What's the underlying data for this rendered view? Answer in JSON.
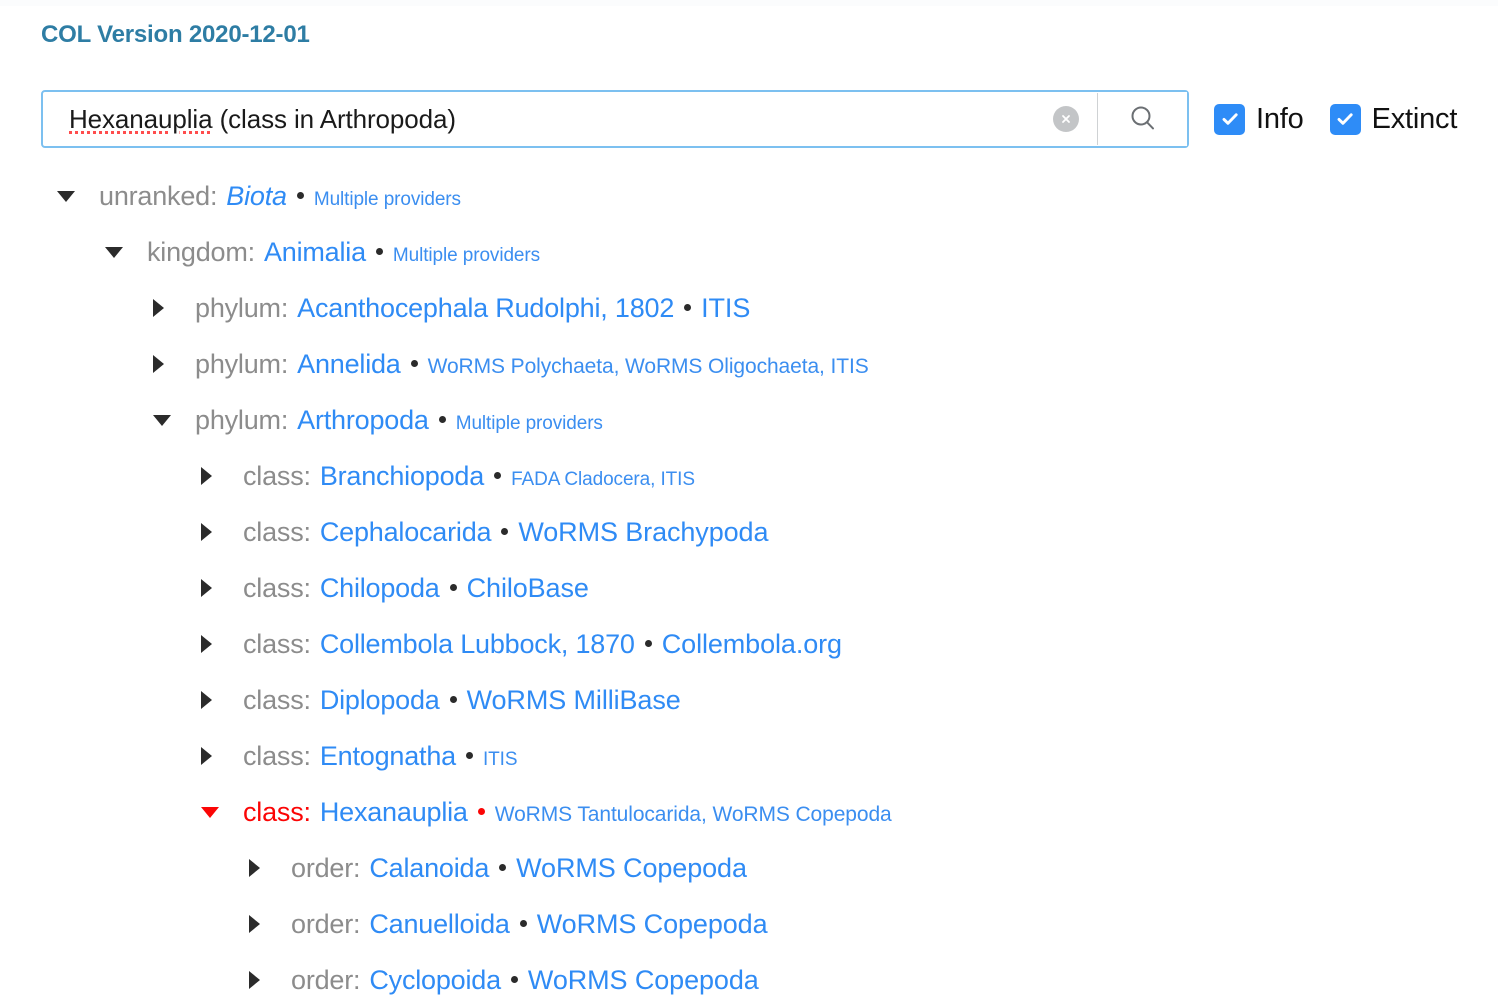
{
  "header": {
    "title": "COL Version 2020-12-01"
  },
  "search": {
    "value": "Hexanauplia (class in Arthropoda)",
    "misspelled_part": "Hexanauplia",
    "rest_part": " (class in Arthropoda)",
    "clear_icon": "clear-circle-x-icon",
    "search_icon": "magnifier-icon"
  },
  "options": [
    {
      "label": "Info",
      "checked": true
    },
    {
      "label": "Extinct",
      "checked": true
    }
  ],
  "tree": [
    {
      "level": 0,
      "state": "expanded",
      "rank": "unranked:",
      "name": "Biota",
      "italic": true,
      "providers": "Multiple providers",
      "provider_size": "sm",
      "selected": false
    },
    {
      "level": 1,
      "state": "expanded",
      "rank": "kingdom:",
      "name": "Animalia",
      "italic": false,
      "providers": "Multiple providers",
      "provider_size": "sm",
      "selected": false
    },
    {
      "level": 2,
      "state": "collapsed",
      "rank": "phylum:",
      "name": "Acanthocephala Rudolphi, 1802",
      "italic": false,
      "providers": "ITIS",
      "provider_size": "lg",
      "selected": false
    },
    {
      "level": 2,
      "state": "collapsed",
      "rank": "phylum:",
      "name": "Annelida",
      "italic": false,
      "providers": "WoRMS Polychaeta, WoRMS Oligochaeta, ITIS",
      "provider_size": "md",
      "selected": false
    },
    {
      "level": 2,
      "state": "expanded",
      "rank": "phylum:",
      "name": "Arthropoda",
      "italic": false,
      "providers": "Multiple providers",
      "provider_size": "sm",
      "selected": false
    },
    {
      "level": 3,
      "state": "collapsed",
      "rank": "class:",
      "name": "Branchiopoda",
      "italic": false,
      "providers": "FADA Cladocera, ITIS",
      "provider_size": "sm",
      "selected": false
    },
    {
      "level": 3,
      "state": "collapsed",
      "rank": "class:",
      "name": "Cephalocarida",
      "italic": false,
      "providers": "WoRMS Brachypoda",
      "provider_size": "lg",
      "selected": false
    },
    {
      "level": 3,
      "state": "collapsed",
      "rank": "class:",
      "name": "Chilopoda",
      "italic": false,
      "providers": "ChiloBase",
      "provider_size": "lg",
      "selected": false
    },
    {
      "level": 3,
      "state": "collapsed",
      "rank": "class:",
      "name": "Collembola Lubbock, 1870",
      "italic": false,
      "providers": "Collembola.org",
      "provider_size": "lg",
      "selected": false
    },
    {
      "level": 3,
      "state": "collapsed",
      "rank": "class:",
      "name": "Diplopoda",
      "italic": false,
      "providers": "WoRMS MilliBase",
      "provider_size": "lg",
      "selected": false
    },
    {
      "level": 3,
      "state": "collapsed",
      "rank": "class:",
      "name": "Entognatha",
      "italic": false,
      "providers": "ITIS",
      "provider_size": "sm",
      "selected": false
    },
    {
      "level": 3,
      "state": "expanded",
      "rank": "class:",
      "name": "Hexanauplia",
      "italic": false,
      "providers": "WoRMS Tantulocarida, WoRMS Copepoda",
      "provider_size": "md",
      "selected": true
    },
    {
      "level": 4,
      "state": "collapsed",
      "rank": "order:",
      "name": "Calanoida",
      "italic": false,
      "providers": "WoRMS Copepoda",
      "provider_size": "lg",
      "selected": false
    },
    {
      "level": 4,
      "state": "collapsed",
      "rank": "order:",
      "name": "Canuelloida",
      "italic": false,
      "providers": "WoRMS Copepoda",
      "provider_size": "lg",
      "selected": false
    },
    {
      "level": 4,
      "state": "collapsed",
      "rank": "order:",
      "name": "Cyclopoida",
      "italic": false,
      "providers": "WoRMS Copepoda",
      "provider_size": "lg",
      "selected": false
    }
  ],
  "colors": {
    "header": "#2e7da4",
    "link": "#2f8bf5",
    "rank": "#8c8c8c",
    "selected": "#fb0505",
    "checkbox": "#2e8cf7",
    "input_border": "#7cc0f0"
  }
}
